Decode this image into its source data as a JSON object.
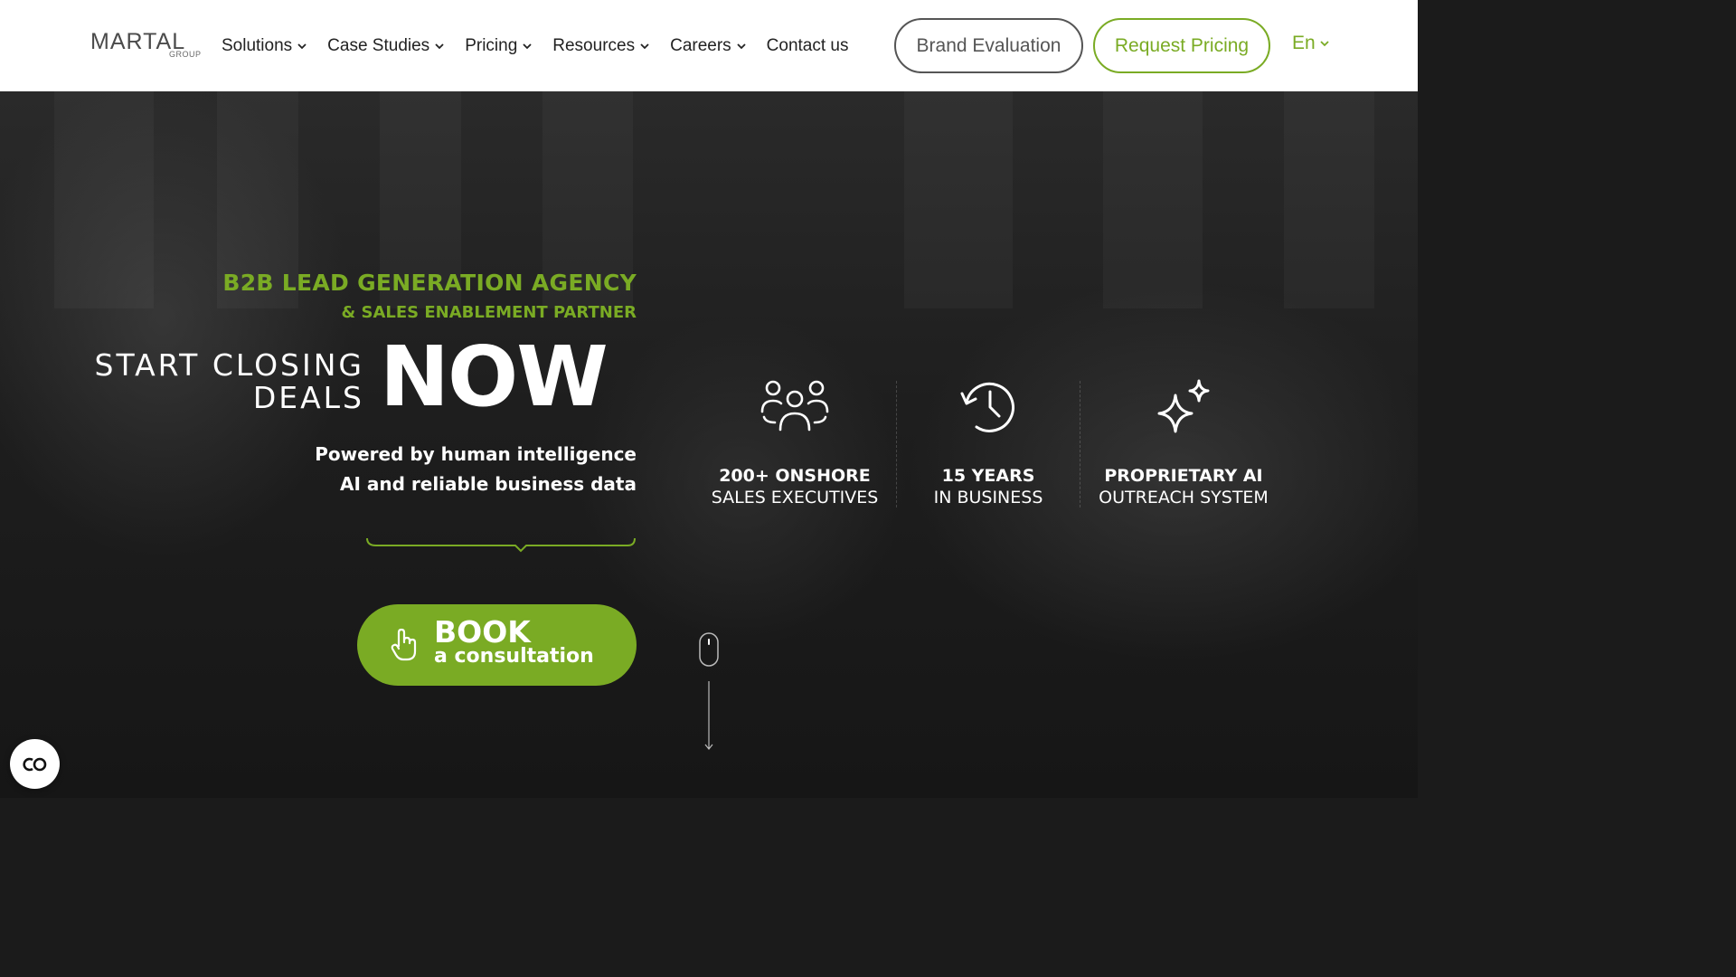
{
  "header": {
    "logo": {
      "main": "MARTAL",
      "sub": "GROUP"
    },
    "nav": [
      {
        "label": "Solutions",
        "has_dropdown": true
      },
      {
        "label": "Case Studies",
        "has_dropdown": true
      },
      {
        "label": "Pricing",
        "has_dropdown": true
      },
      {
        "label": "Resources",
        "has_dropdown": true
      },
      {
        "label": "Careers",
        "has_dropdown": true
      },
      {
        "label": "Contact us",
        "has_dropdown": false
      }
    ],
    "brand_evaluation_label": "Brand Evaluation",
    "request_pricing_label": "Request Pricing",
    "language": "En"
  },
  "hero": {
    "eyebrow_primary": "B2B LEAD GENERATION AGENCY",
    "eyebrow_secondary": "& SALES ENABLEMENT PARTNER",
    "headline_line1": "START CLOSING",
    "headline_line2": "DEALS",
    "headline_emphasis": "NOW",
    "subtitle_line1": "Powered by human intelligence",
    "subtitle_line2": "AI and reliable business data",
    "cta": {
      "line1": "BOOK",
      "line2": "a consultation",
      "icon": "hand-pointer-icon"
    },
    "stats": [
      {
        "strong": "200+ ONSHORE",
        "light": "SALES EXECUTIVES",
        "icon": "people-group-icon"
      },
      {
        "strong": "15 YEARS",
        "light": "IN BUSINESS",
        "icon": "history-clock-icon"
      },
      {
        "strong": "PROPRIETARY AI",
        "light": "OUTREACH SYSTEM",
        "icon": "sparkles-icon"
      }
    ]
  },
  "cookie_widget": {
    "icon": "cookie-consent-icon"
  },
  "colors": {
    "accent": "#7aab24",
    "header_bg": "#ffffff",
    "hero_bg": "#1b1b1b",
    "text_light": "#ffffff",
    "nav_text": "#222222"
  }
}
